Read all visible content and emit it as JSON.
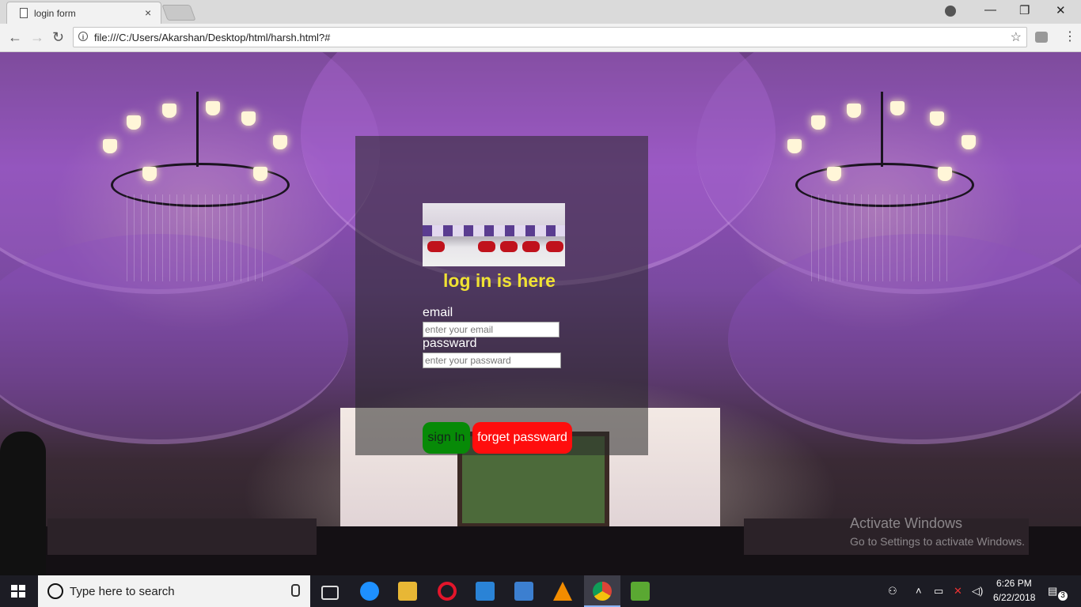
{
  "browser": {
    "tab_title": "login form",
    "tab_close": "×",
    "url": "file:///C:/Users/Akarshan/Desktop/html/harsh.html?#",
    "window_controls": {
      "minimize": "—",
      "restore": "❐",
      "close": "✕"
    },
    "nav": {
      "back": "←",
      "forward": "→",
      "reload": "↻",
      "star": "☆",
      "menu": "⋮",
      "info": "i"
    }
  },
  "login": {
    "heading": "log in is here",
    "email_label": "email",
    "email_placeholder": "enter your email",
    "password_label": "passward",
    "password_placeholder": "enter your passward",
    "signin_label": "sign In",
    "forget_label": "forget passward"
  },
  "watermark": {
    "line1": "Activate Windows",
    "line2": "Go to Settings to activate Windows."
  },
  "taskbar": {
    "search_placeholder": "Type here to search",
    "time": "6:26 PM",
    "date": "6/22/2018",
    "notifications": "3"
  },
  "colors": {
    "heading": "#f0e233",
    "signin_bg": "#078a07",
    "forget_bg": "#ff0d0d",
    "panel_bg": "rgba(40,40,40,0.55)"
  }
}
